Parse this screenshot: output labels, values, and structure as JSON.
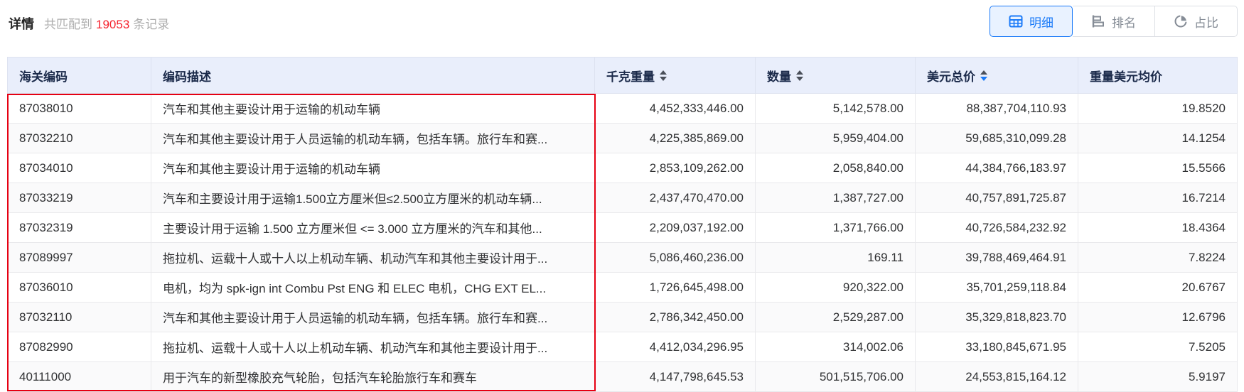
{
  "header": {
    "title": "详情",
    "match_prefix": "共匹配到",
    "match_count": "19053",
    "match_suffix": "条记录",
    "view_buttons": [
      {
        "label": "明细",
        "icon": "table-icon",
        "active": true
      },
      {
        "label": "排名",
        "icon": "ranking-icon",
        "active": false
      },
      {
        "label": "占比",
        "icon": "pie-icon",
        "active": false
      }
    ]
  },
  "table": {
    "columns": [
      {
        "label": "海关编码",
        "key": "code",
        "align": "left",
        "sortable": false,
        "sort": "none"
      },
      {
        "label": "编码描述",
        "key": "desc",
        "align": "left",
        "sortable": false,
        "sort": "none"
      },
      {
        "label": "千克重量",
        "key": "kg",
        "align": "right",
        "sortable": true,
        "sort": "none"
      },
      {
        "label": "数量",
        "key": "qty",
        "align": "right",
        "sortable": true,
        "sort": "none"
      },
      {
        "label": "美元总价",
        "key": "usd",
        "align": "right",
        "sortable": true,
        "sort": "desc"
      },
      {
        "label": "重量美元均价",
        "key": "avg",
        "align": "right",
        "sortable": false,
        "sort": "none"
      }
    ],
    "rows": [
      {
        "code": "87038010",
        "desc": "汽车和其他主要设计用于运输的机动车辆",
        "kg": "4,452,333,446.00",
        "qty": "5,142,578.00",
        "usd": "88,387,704,110.93",
        "avg": "19.8520"
      },
      {
        "code": "87032210",
        "desc": "汽车和其他主要设计用于人员运输的机动车辆，包括车辆。旅行车和赛...",
        "kg": "4,225,385,869.00",
        "qty": "5,959,404.00",
        "usd": "59,685,310,099.28",
        "avg": "14.1254"
      },
      {
        "code": "87034010",
        "desc": "汽车和其他主要设计用于运输的机动车辆",
        "kg": "2,853,109,262.00",
        "qty": "2,058,840.00",
        "usd": "44,384,766,183.97",
        "avg": "15.5566"
      },
      {
        "code": "87033219",
        "desc": "汽车和主要设计用于运输1.500立方厘米但≤2.500立方厘米的机动车辆...",
        "kg": "2,437,470,470.00",
        "qty": "1,387,727.00",
        "usd": "40,757,891,725.87",
        "avg": "16.7214"
      },
      {
        "code": "87032319",
        "desc": "主要设计用于运输 1.500 立方厘米但 <= 3.000 立方厘米的汽车和其他...",
        "kg": "2,209,037,192.00",
        "qty": "1,371,766.00",
        "usd": "40,726,584,232.92",
        "avg": "18.4364"
      },
      {
        "code": "87089997",
        "desc": "拖拉机、运载十人或十人以上机动车辆、机动汽车和其他主要设计用于...",
        "kg": "5,086,460,236.00",
        "qty": "169.11",
        "usd": "39,788,469,464.91",
        "avg": "7.8224"
      },
      {
        "code": "87036010",
        "desc": "电机，均为 spk-ign int Combu Pst ENG 和 ELEC 电机，CHG EXT EL...",
        "kg": "1,726,645,498.00",
        "qty": "920,322.00",
        "usd": "35,701,259,118.84",
        "avg": "20.6767"
      },
      {
        "code": "87032110",
        "desc": "汽车和其他主要设计用于人员运输的机动车辆，包括车辆。旅行车和赛...",
        "kg": "2,786,342,450.00",
        "qty": "2,529,287.00",
        "usd": "35,329,818,823.70",
        "avg": "12.6796"
      },
      {
        "code": "87082990",
        "desc": "拖拉机、运载十人或十人以上机动车辆、机动汽车和其他主要设计用于...",
        "kg": "4,412,034,296.95",
        "qty": "314,002.06",
        "usd": "33,180,845,671.95",
        "avg": "7.5205"
      },
      {
        "code": "40111000",
        "desc": "用于汽车的新型橡胶充气轮胎，包括汽车轮胎旅行车和赛车",
        "kg": "4,147,798,645.53",
        "qty": "501,515,706.00",
        "usd": "24,553,815,164.12",
        "avg": "5.9197"
      }
    ]
  },
  "colors": {
    "accent_blue": "#1a7af8",
    "count_red": "#f5222d",
    "annotation_red": "#e60012",
    "header_bg": "#e9eefb"
  }
}
